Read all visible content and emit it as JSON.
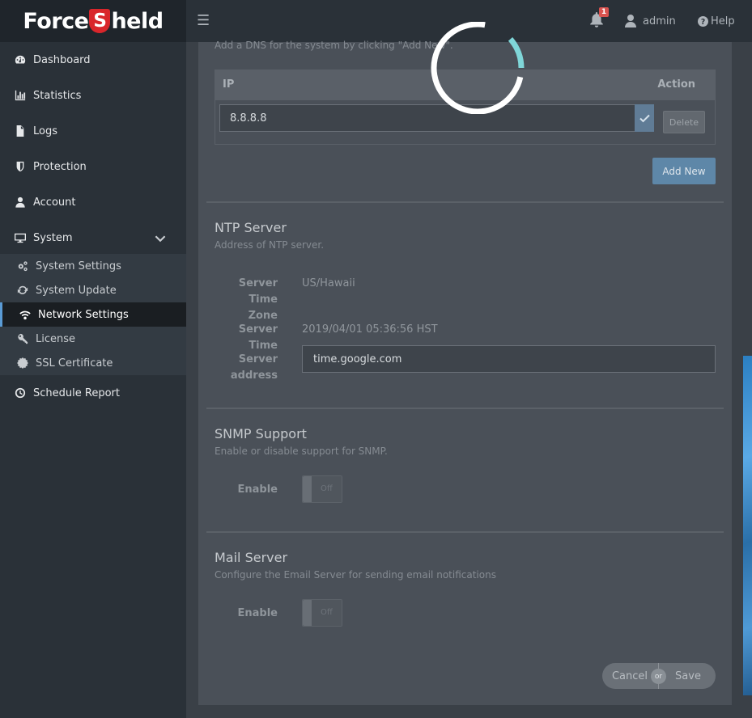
{
  "brand": {
    "name_part1": "Force",
    "name_s": "S",
    "name_part2": "held"
  },
  "topbar": {
    "notification_count": "1",
    "user_name": "admin",
    "help_label": "Help"
  },
  "sidebar": {
    "items": [
      {
        "label": "Dashboard",
        "icon": "dashboard-icon"
      },
      {
        "label": "Statistics",
        "icon": "bar-chart-icon"
      },
      {
        "label": "Logs",
        "icon": "document-icon"
      },
      {
        "label": "Protection",
        "icon": "shield-icon"
      },
      {
        "label": "Account",
        "icon": "user-icon"
      },
      {
        "label": "System",
        "icon": "monitor-icon"
      }
    ],
    "subitems": [
      {
        "label": "System Settings",
        "icon": "gears-icon"
      },
      {
        "label": "System Update",
        "icon": "refresh-icon"
      },
      {
        "label": "Network Settings",
        "icon": "wifi-icon",
        "active": true
      },
      {
        "label": "License",
        "icon": "key-icon"
      },
      {
        "label": "SSL Certificate",
        "icon": "certificate-icon"
      }
    ],
    "schedule_report": {
      "label": "Schedule Report",
      "icon": "clock-icon"
    }
  },
  "dns": {
    "hint": "Add a DNS for the system by clicking \"Add New\".",
    "col_ip": "IP",
    "col_action": "Action",
    "ip_value": "8.8.8.8",
    "delete_label": "Delete",
    "add_new_label": "Add New"
  },
  "ntp": {
    "title": "NTP Server",
    "subtitle": "Address of NTP server.",
    "timezone_label_1": "Server Time",
    "timezone_label_2": "Zone",
    "timezone_value": "US/Hawaii",
    "time_label": "Server Time",
    "time_value": "2019/04/01 05:36:56 HST",
    "address_label_1": "Server",
    "address_label_2": "address",
    "address_value": "time.google.com"
  },
  "snmp": {
    "title": "SNMP Support",
    "subtitle": "Enable or disable support for SNMP.",
    "enable_label": "Enable",
    "toggle_state": "Off"
  },
  "mail": {
    "title": "Mail Server",
    "subtitle": "Configure the Email Server for sending email notifications",
    "enable_label": "Enable",
    "toggle_state": "Off"
  },
  "actions": {
    "cancel_label": "Cancel",
    "or_label": "or",
    "save_label": "Save"
  },
  "colors": {
    "brand_red": "#d9262b",
    "active_accent": "#5a9bd5",
    "spinner_accent": "#7fd6d8"
  }
}
